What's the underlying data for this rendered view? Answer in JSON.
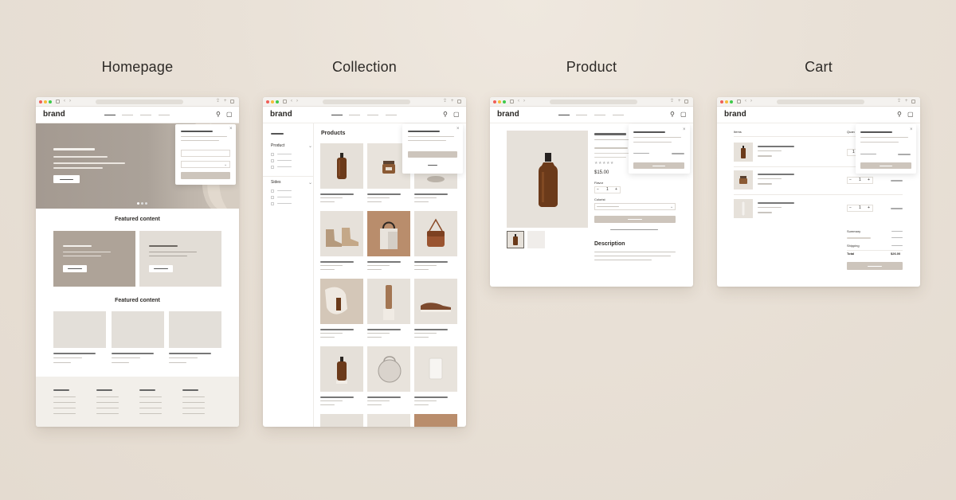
{
  "labels": [
    "Homepage",
    "Collection",
    "Product",
    "Cart"
  ],
  "brand": "brand",
  "homepage": {
    "featured_title_1": "Featured content",
    "featured_title_2": "Featured content"
  },
  "collection": {
    "title": "Products",
    "filters": [
      "Product",
      "Sides"
    ]
  },
  "product": {
    "price": "$15.00",
    "option_label": "Flavor",
    "quantity": "1",
    "select_label": "Colorist",
    "description_title": "Description"
  },
  "cart": {
    "col_item": "Items",
    "col_qty": "Quan",
    "quantities": [
      "1",
      "1",
      "1"
    ],
    "summary_label": "Summary",
    "shipping_label": "Shipping",
    "total_label": "Total",
    "total_value": "$26.00"
  },
  "icons": [
    "search-icon",
    "bag-icon",
    "close-icon",
    "chevron-down-icon",
    "sidebar-icon",
    "share-icon",
    "plus-icon",
    "tabs-icon"
  ],
  "colors": {
    "accent": "#c9c0b6",
    "text": "#2d2a27",
    "product_amber": "#6b3a1a"
  }
}
